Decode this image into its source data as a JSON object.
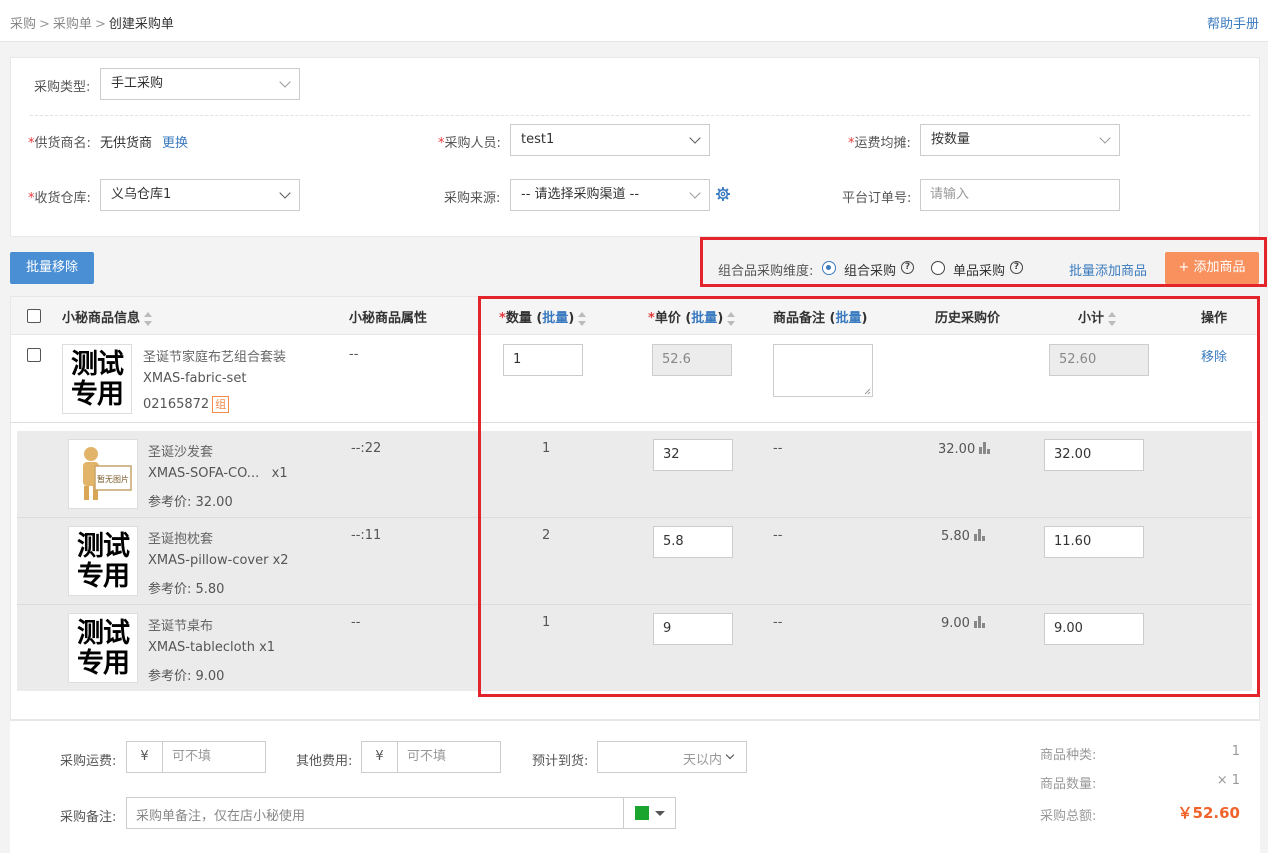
{
  "breadcrumb": {
    "items": [
      "采购",
      "采购单",
      "创建采购单"
    ]
  },
  "help_link": "帮助手册",
  "form": {
    "purchase_type_label": "采购类型:",
    "purchase_type_value": "手工采购",
    "supplier_label": "供货商名:",
    "supplier_value": "无供货商",
    "supplier_change": "更换",
    "buyer_label": "采购人员:",
    "buyer_value": "test1",
    "freight_split_label": "运费均摊:",
    "freight_split_value": "按数量",
    "warehouse_label": "收货仓库:",
    "warehouse_value": "义乌仓库1",
    "source_label": "采购来源:",
    "source_value": "-- 请选择采购渠道 --",
    "platform_order_label": "平台订单号:",
    "platform_order_placeholder": "请输入"
  },
  "toolbar": {
    "batch_remove": "批量移除",
    "combo_dimension_label": "组合品采购维度:",
    "radio_combo": "组合采购",
    "radio_single": "单品采购",
    "radio_selected": "组合采购",
    "batch_add": "批量添加商品",
    "add_product": "+ 添加商品"
  },
  "table": {
    "headers": {
      "info": "小秘商品信息",
      "attr": "小秘商品属性",
      "qty": "数量",
      "price": "单价",
      "note": "商品备注",
      "history": "历史采购价",
      "subtotal": "小计",
      "action": "操作",
      "batch": "批量"
    },
    "main_row": {
      "thumb_text": [
        "测试",
        "专用"
      ],
      "name": "圣诞节家庭布艺组合套装",
      "sku": "XMAS-fabric-set",
      "code": "02165872",
      "tag": "组",
      "attr": "--",
      "qty": "1",
      "price": "52.6",
      "note": "",
      "subtotal": "52.60",
      "action": "移除"
    },
    "sub_rows": [
      {
        "thumb": "no-image",
        "thumb_caption": "暂无图片",
        "name": "圣诞沙发套",
        "sku": "XMAS-SOFA-CO...",
        "mult": "x1",
        "ref_price": "参考价: 32.00",
        "attr": "--:22",
        "qty": "1",
        "price": "32",
        "note": "--",
        "history": "32.00",
        "subtotal": "32.00"
      },
      {
        "thumb": "test",
        "thumb_text": [
          "测试",
          "专用"
        ],
        "name": "圣诞抱枕套",
        "sku": "XMAS-pillow-cover",
        "mult": "x2",
        "ref_price": "参考价: 5.80",
        "attr": "--:11",
        "qty": "2",
        "price": "5.8",
        "note": "--",
        "history": "5.80",
        "subtotal": "11.60"
      },
      {
        "thumb": "test",
        "thumb_text": [
          "测试",
          "专用"
        ],
        "name": "圣诞节桌布",
        "sku": "XMAS-tablecloth",
        "mult": "x1",
        "ref_price": "参考价: 9.00",
        "attr": "--",
        "qty": "1",
        "price": "9",
        "note": "--",
        "history": "9.00",
        "subtotal": "9.00"
      }
    ]
  },
  "footer": {
    "freight_label": "采购运费:",
    "freight_currency": "¥",
    "freight_placeholder": "可不填",
    "other_label": "其他费用:",
    "other_currency": "¥",
    "other_placeholder": "可不填",
    "eta_label": "预计到货:",
    "eta_unit": "天以内",
    "remark_label": "采购备注:",
    "remark_placeholder": "采购单备注，仅在店小秘使用",
    "color_flag": "#1aa52f",
    "summary": {
      "kinds_label": "商品种类:",
      "kinds_value": "1",
      "count_label": "商品数量:",
      "count_value": "× 1",
      "total_label": "采购总额:",
      "total_value": "￥52.60"
    }
  }
}
